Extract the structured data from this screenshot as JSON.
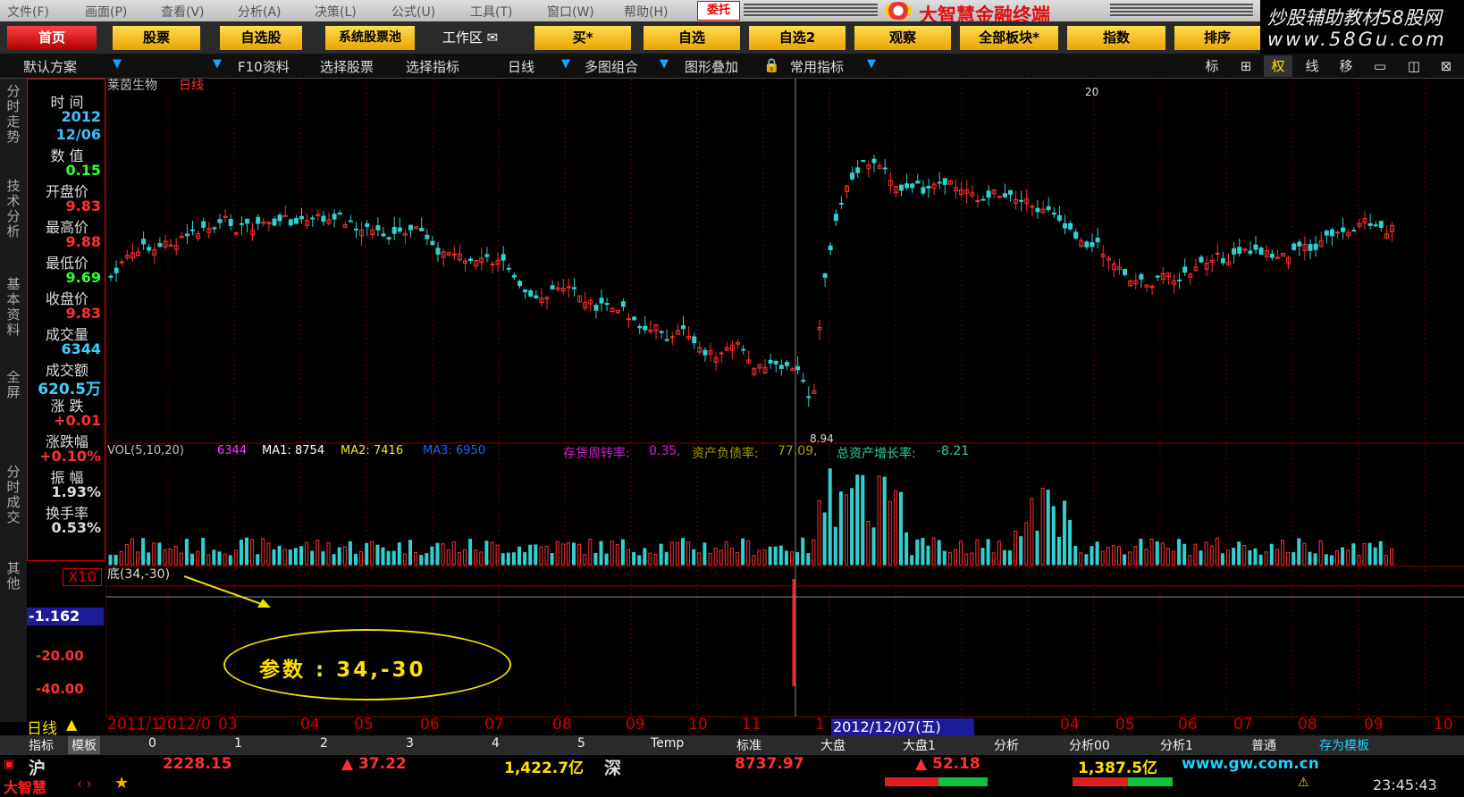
{
  "menu": {
    "items": [
      "文件(F)",
      "画面(P)",
      "查看(V)",
      "分析(A)",
      "决策(L)",
      "公式(U)",
      "工具(T)",
      "窗口(W)",
      "帮助(H)"
    ],
    "entrust": "委托",
    "brand": "大智慧金融终端"
  },
  "toolbar": {
    "buttons": [
      "首页",
      "股票",
      "自选股",
      "系统股票池",
      "工作区",
      "买*",
      "自选",
      "自选2",
      "观察",
      "全部板块*",
      "指数",
      "排序"
    ]
  },
  "watermark": {
    "line1": "炒股辅助教材58股网",
    "line2": "www.58Gu.com"
  },
  "subbar": {
    "items": [
      "默认方案",
      "F10资料",
      "选择股票",
      "选择指标",
      "日线",
      "多图组合",
      "图形叠加",
      "常用指标"
    ],
    "right_icons": [
      "标",
      "⊞",
      "权",
      "线",
      "移",
      "▭",
      "◫",
      "⊠"
    ]
  },
  "vtabs": [
    "分时走势",
    "技术分析",
    "基本资料",
    "全屏",
    "分时成交",
    "其他"
  ],
  "info": {
    "labels": [
      "时  间",
      "数  值",
      "开盘价",
      "最高价",
      "最低价",
      "收盘价",
      "成交量",
      "成交额",
      "涨  跌",
      "涨跌幅",
      "振  幅",
      "换手率"
    ],
    "values": [
      "2012",
      "12/06",
      "0.15",
      "9.83",
      "9.88",
      "9.69",
      "9.83",
      "6344",
      "620.5万",
      "+0.01",
      "+0.10%",
      "1.93%",
      "0.53%"
    ],
    "x10": "X10"
  },
  "chart": {
    "stock": "莱茵生物",
    "period": "日线",
    "low_label": "8.94",
    "high_label": "20",
    "vol_line": {
      "name": "VOL(5,10,20)",
      "v": "6344",
      "ma1_label": "MA1:",
      "ma1": "8754",
      "ma2_label": "MA2:",
      "ma2": "7416",
      "ma3_label": "MA3:",
      "ma3": "6950"
    },
    "fin": {
      "inv_label": "存货周转率:",
      "inv": "0.35,",
      "debt_label": "资产负债率:",
      "debt": "77.09,",
      "growth_label": "总资产增长率:",
      "growth": "-8.21"
    },
    "ind_name": "底(34,-30)",
    "ind_value": "-1.162",
    "ind_ticks": [
      "-20.00",
      "-40.00"
    ],
    "param_text": "参数 : 34,-30",
    "date_axis": [
      "日线",
      "2011/1",
      "2012/0",
      "03",
      "04",
      "05",
      "06",
      "07",
      "08",
      "09",
      "10",
      "11",
      "1",
      "04",
      "05",
      "06",
      "07",
      "08",
      "09",
      "10"
    ],
    "cursor_date": "2012/12/07(五)",
    "colors": {
      "up": "#ff3030",
      "down": "#30d0d0",
      "ma1": "#ffffff",
      "ma2": "#f0f000",
      "ma3": "#2060ff",
      "grid": "#6a0000"
    }
  },
  "templates": [
    "指标",
    "模板",
    "0",
    "1",
    "2",
    "3",
    "4",
    "5",
    "Temp",
    "标准",
    "大盘",
    "大盘1",
    "分析",
    "分析00",
    "分析1",
    "普通",
    "存为模板"
  ],
  "ticker": {
    "sh_label": "沪",
    "sh_index": "2228.15",
    "sh_change": "▲ 37.22",
    "sh_amount": "1,422.7亿",
    "sz_label": "深",
    "sz_index": "8737.97",
    "sz_change": "▲ 52.18",
    "sz_amount": "1,387.5亿",
    "url": "www.gw.com.cn"
  },
  "bottom": {
    "brand": "大智慧",
    "time": "23:45:43"
  }
}
